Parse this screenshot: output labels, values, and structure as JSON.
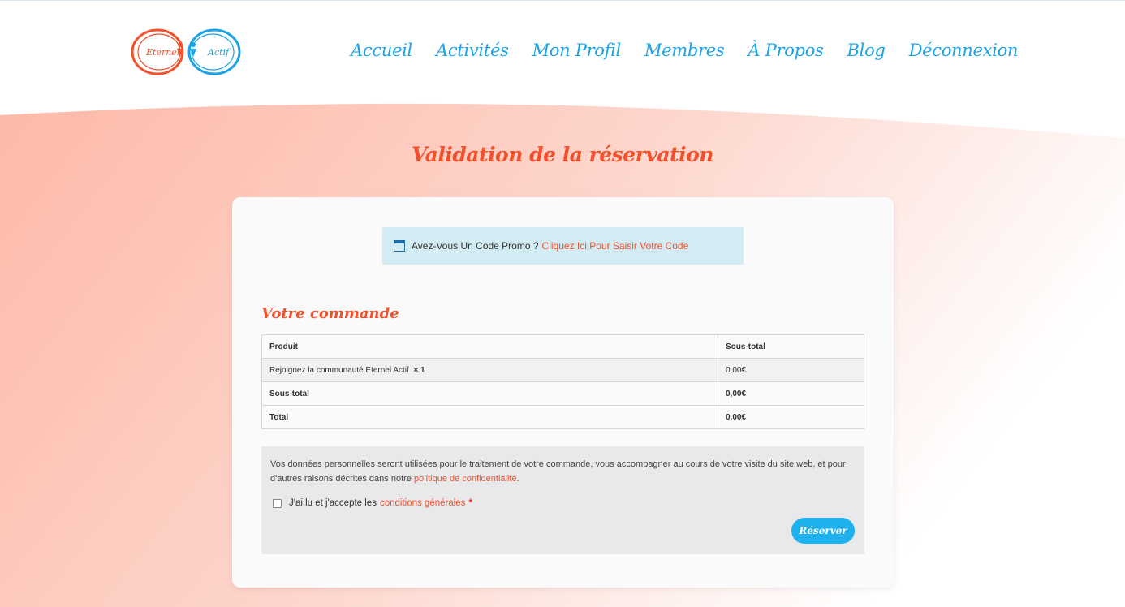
{
  "brand": {
    "logo_text_left": "Eternel",
    "logo_text_right": "Actif",
    "color_left": "#f2512b",
    "color_right": "#1aa3e6"
  },
  "nav": {
    "items": [
      {
        "label": "Accueil"
      },
      {
        "label": "Activités"
      },
      {
        "label": "Mon Profil"
      },
      {
        "label": "Membres"
      },
      {
        "label": "À Propos"
      },
      {
        "label": "Blog"
      },
      {
        "label": "Déconnexion"
      }
    ]
  },
  "page": {
    "title": "Validation de la réservation"
  },
  "promo": {
    "icon": "calendar-icon",
    "text": "Avez-Vous Un Code Promo ?",
    "link": "Cliquez Ici Pour Saisir Votre Code"
  },
  "order": {
    "title": "Votre commande",
    "headers": {
      "product": "Produit",
      "subtotal": "Sous-total"
    },
    "item": {
      "name": "Rejoignez la communauté Eternel Actif",
      "qty": "× 1",
      "price": "0,00€"
    },
    "subtotal": {
      "label": "Sous-total",
      "value": "0,00€"
    },
    "total": {
      "label": "Total",
      "value": "0,00€"
    }
  },
  "payment": {
    "privacy_text": "Vos données personnelles seront utilisées pour le traitement de votre commande, vous accompagner au cours de votre visite du site web, et pour d'autres raisons décrites dans notre",
    "privacy_link": "politique de confidentialité",
    "privacy_end": ".",
    "terms_text": "J'ai lu et j'accepte les",
    "terms_link": "conditions générales",
    "terms_required": "*",
    "button": "Réserver"
  },
  "colors": {
    "accent": "#f2512b",
    "blue": "#1aa3e6",
    "bg_pink": "#fdc6b8"
  }
}
